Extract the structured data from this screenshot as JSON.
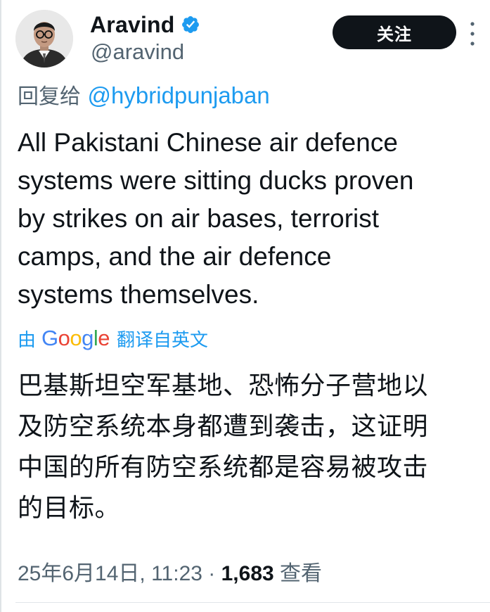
{
  "author": {
    "display_name": "Aravind",
    "handle": "@aravind",
    "verified": true,
    "avatar_icon": "portrait-avatar"
  },
  "follow_button": {
    "label": "关注"
  },
  "reply": {
    "prefix": "回复给 ",
    "mention": "@hybridpunjaban"
  },
  "tweet": {
    "lines": [
      "All Pakistani Chinese air defence",
      "systems were sitting ducks proven",
      "by strikes on air bases, terrorist",
      "camps, and the air defence",
      "systems themselves."
    ]
  },
  "translation": {
    "prefix": "由",
    "provider": "Google",
    "suffix": "翻译自英文",
    "lines": [
      "巴基斯坦空军基地、恐怖分子营地以",
      "及防空系统本身都遭到袭击，这证明",
      "中国的所有防空系统都是容易被攻击",
      "的目标。"
    ]
  },
  "meta": {
    "timestamp": "25年6月14日, 11:23",
    "separator": " · ",
    "views_count": "1,683",
    "views_label": " 查看"
  },
  "colors": {
    "text": "#0f1419",
    "secondary": "#536471",
    "accent": "#1d9bf0",
    "button_bg": "#0f1419"
  }
}
